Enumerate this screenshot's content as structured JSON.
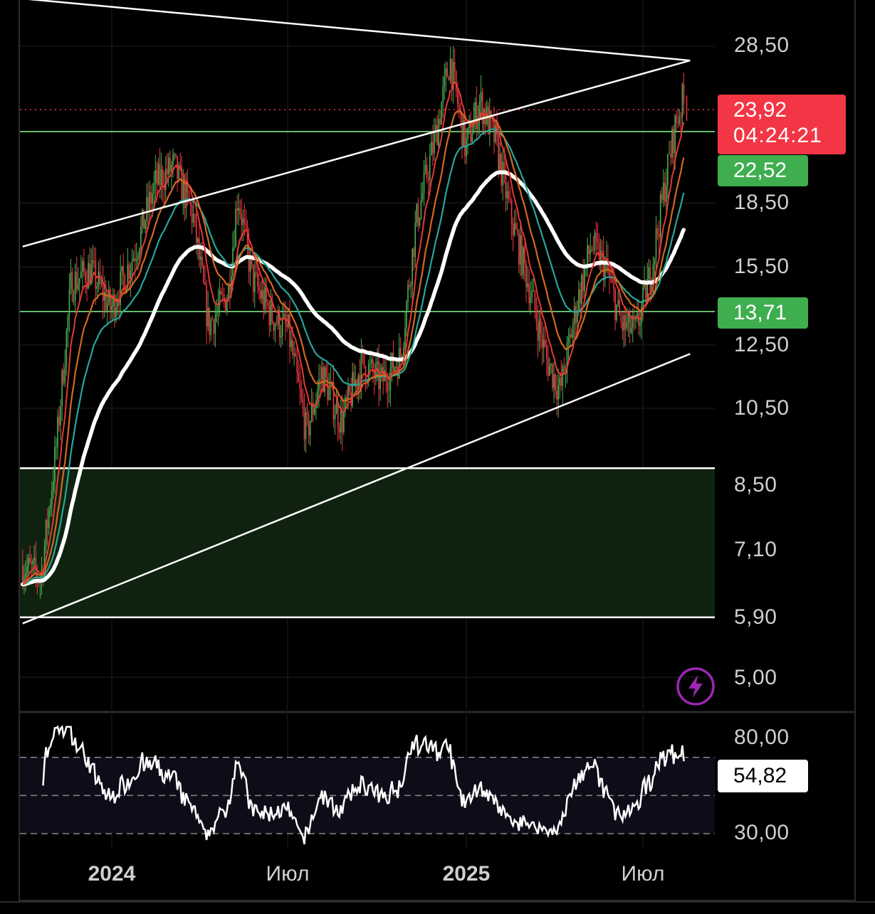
{
  "price_scale": {
    "ticks": [
      "28,50",
      "18,50",
      "15,50",
      "12,50",
      "10,50",
      "8,50",
      "7,10",
      "5,90",
      "5,00"
    ]
  },
  "rsi_scale": {
    "ticks": [
      "80,00",
      "30,00"
    ]
  },
  "time_axis": {
    "labels": [
      {
        "text": "2024",
        "bold": true
      },
      {
        "text": "Июл",
        "bold": false
      },
      {
        "text": "2025",
        "bold": true
      },
      {
        "text": "Июл",
        "bold": false
      }
    ]
  },
  "badges": {
    "last_price": "23,92",
    "countdown": "04:24:21",
    "level_high": "22,52",
    "level_low": "13,71",
    "rsi_value": "54,82"
  },
  "icons": {
    "alert": "lightning-bolt-icon"
  },
  "colors": {
    "background": "#000000",
    "up_candle": "#4caf50",
    "down_candle": "#f23645",
    "ema_fast": "#e53935",
    "ema_mid": "#d2691e",
    "ema_slow": "#26a69a",
    "ema_long": "#ffffff",
    "level_line": "#66bb6a",
    "zone_fill": "#0f2210",
    "bolt": "#9c27b0"
  },
  "chart_data": [
    {
      "type": "candlestick",
      "scale": "log",
      "y_ticks": [
        28.5,
        18.5,
        15.5,
        12.5,
        10.5,
        8.5,
        7.1,
        5.9,
        5.0
      ],
      "x_labels": [
        "2024",
        "Июл",
        "2025",
        "Июл"
      ],
      "last_price": 23.92,
      "horizontal_levels": [
        22.52,
        13.71
      ],
      "zone": [
        5.9,
        8.9
      ],
      "trendlines": [
        {
          "from": [
            "2023-10-01",
            32.5
          ],
          "to": [
            "2025-08-20",
            27.4
          ]
        },
        {
          "from": [
            "2023-10-01",
            16.4
          ],
          "to": [
            "2025-08-20",
            27.4
          ]
        },
        {
          "from": [
            "2023-10-01",
            5.8
          ],
          "to": [
            "2025-08-20",
            12.2
          ]
        }
      ],
      "close_path": [
        {
          "t": "2023-10-01",
          "v": 6.8
        },
        {
          "t": "2023-10-20",
          "v": 6.6
        },
        {
          "t": "2023-11-05",
          "v": 9.5
        },
        {
          "t": "2023-11-20",
          "v": 14.8
        },
        {
          "t": "2023-12-10",
          "v": 15.4
        },
        {
          "t": "2023-12-31",
          "v": 13.8
        },
        {
          "t": "2024-01-25",
          "v": 16.2
        },
        {
          "t": "2024-02-15",
          "v": 19.5
        },
        {
          "t": "2024-03-05",
          "v": 20.5
        },
        {
          "t": "2024-03-25",
          "v": 17.8
        },
        {
          "t": "2024-04-10",
          "v": 13.2
        },
        {
          "t": "2024-04-30",
          "v": 14.4
        },
        {
          "t": "2024-05-10",
          "v": 19.0
        },
        {
          "t": "2024-05-25",
          "v": 15.0
        },
        {
          "t": "2024-06-15",
          "v": 13.5
        },
        {
          "t": "2024-07-01",
          "v": 13.0
        },
        {
          "t": "2024-07-20",
          "v": 9.8
        },
        {
          "t": "2024-08-05",
          "v": 11.6
        },
        {
          "t": "2024-08-25",
          "v": 10.1
        },
        {
          "t": "2024-09-15",
          "v": 11.9
        },
        {
          "t": "2024-10-05",
          "v": 11.3
        },
        {
          "t": "2024-10-25",
          "v": 12.1
        },
        {
          "t": "2024-11-10",
          "v": 17.5
        },
        {
          "t": "2024-12-01",
          "v": 22.5
        },
        {
          "t": "2024-12-15",
          "v": 27.5
        },
        {
          "t": "2024-12-31",
          "v": 21.5
        },
        {
          "t": "2025-01-15",
          "v": 24.5
        },
        {
          "t": "2025-01-31",
          "v": 22.0
        },
        {
          "t": "2025-02-15",
          "v": 18.0
        },
        {
          "t": "2025-03-05",
          "v": 15.0
        },
        {
          "t": "2025-03-25",
          "v": 12.0
        },
        {
          "t": "2025-04-08",
          "v": 11.0
        },
        {
          "t": "2025-04-25",
          "v": 14.0
        },
        {
          "t": "2025-05-10",
          "v": 16.5
        },
        {
          "t": "2025-05-25",
          "v": 15.5
        },
        {
          "t": "2025-06-10",
          "v": 13.2
        },
        {
          "t": "2025-06-25",
          "v": 13.0
        },
        {
          "t": "2025-07-10",
          "v": 15.2
        },
        {
          "t": "2025-07-25",
          "v": 19.5
        },
        {
          "t": "2025-08-05",
          "v": 23.0
        },
        {
          "t": "2025-08-12",
          "v": 24.5
        },
        {
          "t": "2025-08-15",
          "v": 23.92
        }
      ]
    },
    {
      "type": "line",
      "name": "RSI",
      "y_ticks": [
        80.0,
        30.0
      ],
      "bands": [
        70,
        50,
        30
      ],
      "last_value": 54.82
    }
  ]
}
